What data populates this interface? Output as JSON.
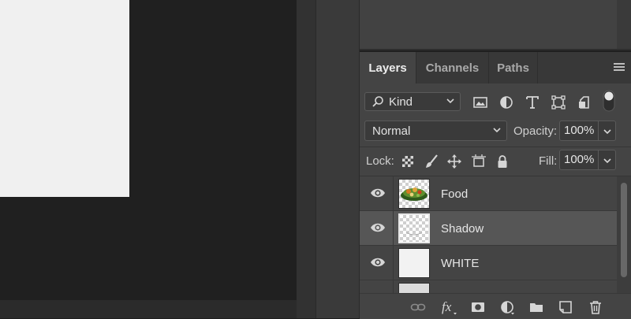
{
  "layers_panel": {
    "tabs": [
      {
        "label": "Layers",
        "active": true
      },
      {
        "label": "Channels",
        "active": false
      },
      {
        "label": "Paths",
        "active": false
      }
    ],
    "filter": {
      "kind_label": "Kind"
    },
    "blend_mode": "Normal",
    "opacity_label": "Opacity:",
    "opacity_value": "100%",
    "lock_label": "Lock:",
    "fill_label": "Fill:",
    "fill_value": "100%",
    "layers": [
      {
        "name": "Food",
        "visible": true,
        "selected": false,
        "thumbnail": "food-salad"
      },
      {
        "name": "Shadow",
        "visible": true,
        "selected": true,
        "thumbnail": "transparent-shadow"
      },
      {
        "name": "WHITE",
        "visible": true,
        "selected": false,
        "thumbnail": "white-fill"
      }
    ],
    "bottom_icons": [
      "link-icon",
      "fx-icon",
      "mask-icon",
      "adjustment-icon",
      "folder-icon",
      "new-layer-icon",
      "trash-icon"
    ]
  },
  "colors": {
    "panel_bg": "#444444",
    "selected_row": "#565656",
    "canvas_bg": "#202020",
    "document": "#f0f0f0"
  }
}
